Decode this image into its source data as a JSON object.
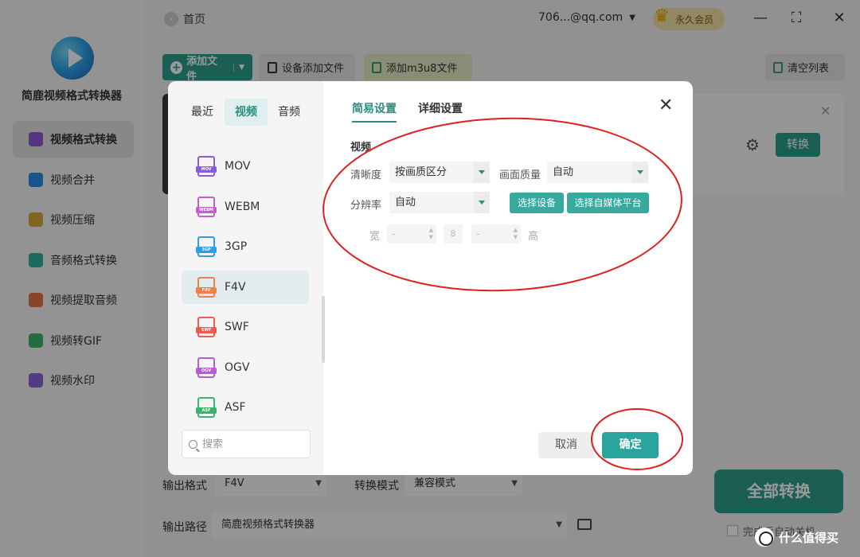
{
  "app": {
    "name": "简鹿视频格式转换器",
    "nav": [
      {
        "label": "视频格式转换",
        "active": true,
        "color": "#8c5bd6"
      },
      {
        "label": "视频合并",
        "active": false,
        "color": "#2c8de8"
      },
      {
        "label": "视频压缩",
        "active": false,
        "color": "#d6a83b"
      },
      {
        "label": "音频格式转换",
        "active": false,
        "color": "#31b0a0"
      },
      {
        "label": "视频提取音频",
        "active": false,
        "color": "#e2744a"
      },
      {
        "label": "视频转GIF",
        "active": false,
        "color": "#3fb36a"
      },
      {
        "label": "视频水印",
        "active": false,
        "color": "#8a63d8"
      }
    ]
  },
  "topbar": {
    "home": "首页",
    "account": "706...@qq.com",
    "vip": "永久会员",
    "crown_label": "VIP"
  },
  "toolbar": {
    "add_file": "添加文件",
    "device_add": "设备添加文件",
    "add_m3u8": "添加m3u8文件",
    "clear_list": "清空列表"
  },
  "file_card": {
    "convert": "转换"
  },
  "bottom": {
    "output_format_label": "输出格式",
    "output_format_value": "F4V",
    "mode_label": "转换模式",
    "mode_value": "兼容模式",
    "path_label": "输出路径",
    "path_value": "简鹿视频格式转换器",
    "convert_all": "全部转换",
    "after_text": "完成后自动关机"
  },
  "dialog": {
    "categories": [
      "最近",
      "视频",
      "音频"
    ],
    "active_category": "视频",
    "formats": [
      {
        "name": "MOV",
        "color": "#8a5bd6"
      },
      {
        "name": "WEBM",
        "color": "#c260c9"
      },
      {
        "name": "3GP",
        "color": "#2d9ee6"
      },
      {
        "name": "F4V",
        "color": "#f07d4a"
      },
      {
        "name": "SWF",
        "color": "#ef5a4c"
      },
      {
        "name": "OGV",
        "color": "#b45dd6"
      },
      {
        "name": "ASF",
        "color": "#3bb46e"
      }
    ],
    "active_format": "F4V",
    "search_placeholder": "搜索",
    "tabs": [
      "简易设置",
      "详细设置"
    ],
    "active_tab": "简易设置",
    "section": "视频",
    "fields": {
      "clarity_label": "清晰度",
      "clarity_value": "按画质区分",
      "quality_label": "画面质量",
      "quality_value": "自动",
      "resolution_label": "分辨率",
      "resolution_value": "自动",
      "select_device": "选择设备",
      "select_platform": "选择自媒体平台",
      "width_label": "宽",
      "height_label": "高",
      "width_value": "-",
      "height_value": "-"
    },
    "cancel": "取消",
    "ok": "确定"
  },
  "watermark": "什么值得买",
  "colors": {
    "accent": "#2e9f8c",
    "annotation": "#e02020"
  }
}
